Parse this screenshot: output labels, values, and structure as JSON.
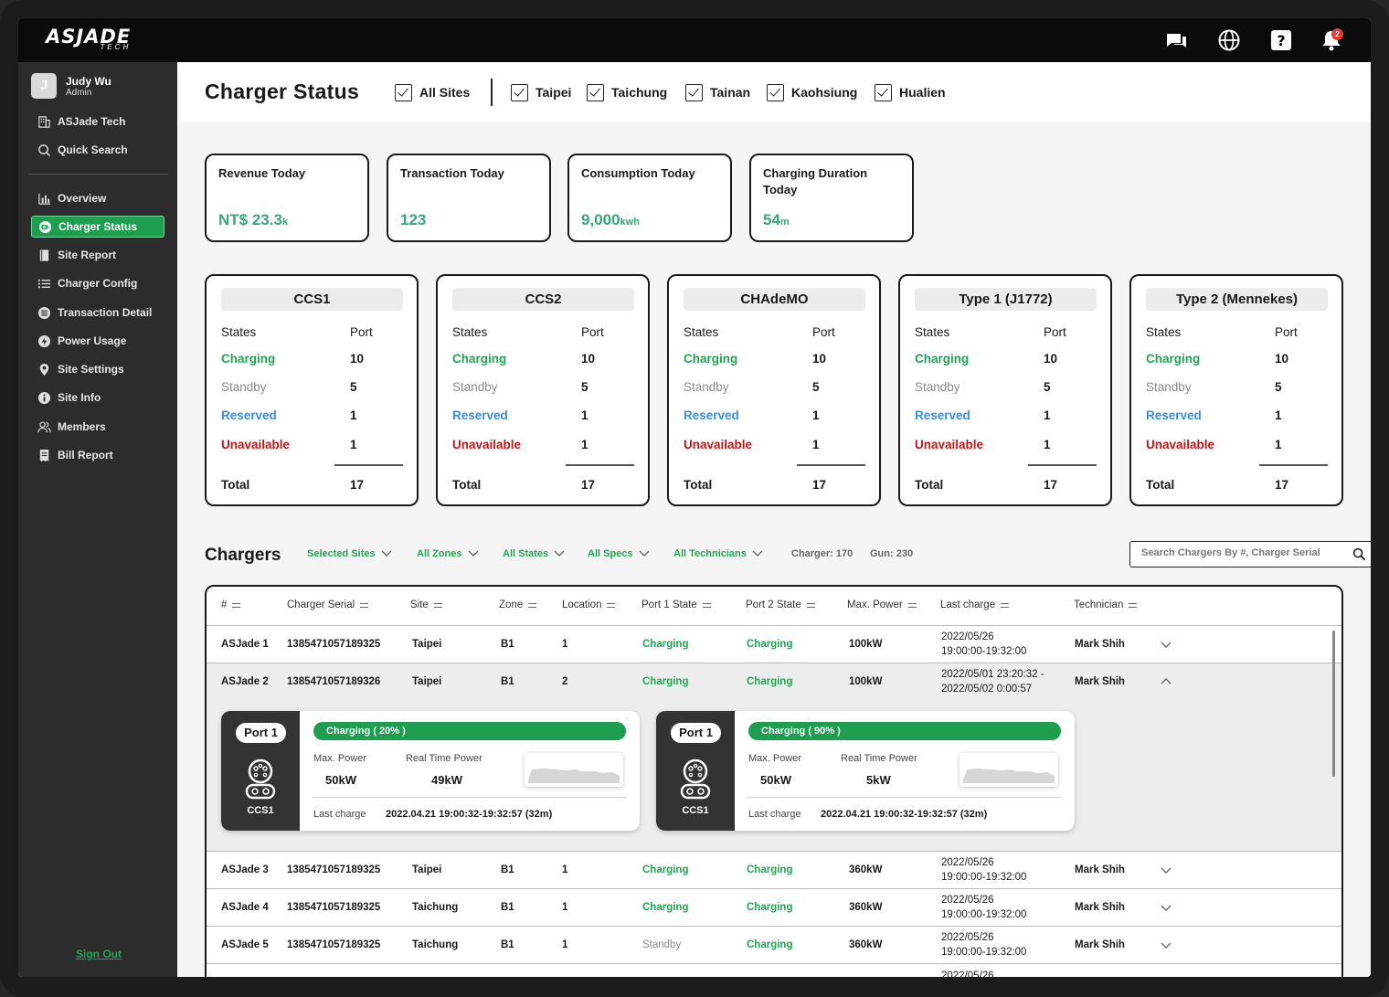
{
  "brand": {
    "logo_top": "ASJADE",
    "logo_bottom": "TECH",
    "accent": "#1e9e4f",
    "notification_count": "2"
  },
  "topbar_icons": [
    "chat-icon",
    "globe-icon",
    "help-icon",
    "bell-icon"
  ],
  "user": {
    "initial": "J",
    "name": "Judy Wu",
    "role": "Admin"
  },
  "sidebar": {
    "top_items": [
      {
        "label": "ASJade Tech",
        "icon": "building-icon"
      },
      {
        "label": "Quick Search",
        "icon": "search-icon"
      }
    ],
    "items": [
      {
        "label": "Overview",
        "icon": "bar-chart-icon"
      },
      {
        "label": "Charger Status",
        "icon": "plug-icon",
        "active": true
      },
      {
        "label": "Site Report",
        "icon": "book-icon"
      },
      {
        "label": "Charger Config",
        "icon": "list-icon"
      },
      {
        "label": "Transaction Detail",
        "icon": "menu-circle-icon"
      },
      {
        "label": "Power Usage",
        "icon": "bolt-icon"
      },
      {
        "label": "Site Settings",
        "icon": "pin-icon"
      },
      {
        "label": "Site Info",
        "icon": "info-icon"
      },
      {
        "label": "Members",
        "icon": "people-icon"
      },
      {
        "label": "Bill Report",
        "icon": "receipt-icon"
      }
    ],
    "sign_out": "Sign Out"
  },
  "header": {
    "title": "Charger Status",
    "all_sites": "All Sites",
    "sites": [
      "Taipei",
      "Taichung",
      "Tainan",
      "Kaohsiung",
      "Hualien"
    ]
  },
  "kpis": [
    {
      "title": "Revenue Today",
      "value": "NT$ 23.3",
      "unit": "k"
    },
    {
      "title": "Transaction Today",
      "value": "123",
      "unit": ""
    },
    {
      "title": "Consumption Today",
      "value": "9,000",
      "unit": "kwh"
    },
    {
      "title": "Charging Duration Today",
      "value": "54",
      "unit": "m"
    }
  ],
  "connector_headers": {
    "states": "States",
    "port": "Port",
    "total": "Total"
  },
  "connectors": [
    {
      "name": "CCS1",
      "charging": "10",
      "standby": "5",
      "reserved": "1",
      "unavailable": "1",
      "total": "17"
    },
    {
      "name": "CCS2",
      "charging": "10",
      "standby": "5",
      "reserved": "1",
      "unavailable": "1",
      "total": "17"
    },
    {
      "name": "CHAdeMO",
      "charging": "10",
      "standby": "5",
      "reserved": "1",
      "unavailable": "1",
      "total": "17"
    },
    {
      "name": "Type 1 (J1772)",
      "charging": "10",
      "standby": "5",
      "reserved": "1",
      "unavailable": "1",
      "total": "17"
    },
    {
      "name": "Type 2 (Mennekes)",
      "charging": "10",
      "standby": "5",
      "reserved": "1",
      "unavailable": "1",
      "total": "17"
    }
  ],
  "state_labels": {
    "charging": "Charging",
    "standby": "Standby",
    "reserved": "Reserved",
    "unavailable": "Unavailable"
  },
  "chargers": {
    "title": "Chargers",
    "filters": [
      "Selected Sites",
      "All Zones",
      "All States",
      "All Specs",
      "All Technicians"
    ],
    "charger_count": "Charger: 170",
    "gun_count": "Gun: 230",
    "search_placeholder": "Search Chargers By #, Charger Serial",
    "columns": [
      "#",
      "Charger Serial",
      "Site",
      "Zone",
      "Location",
      "Port 1 State",
      "Port 2 State",
      "Max. Power",
      "Last charge",
      "Technician"
    ],
    "rows": [
      {
        "id": "ASJade 1",
        "serial": "1385471057189325",
        "site": "Taipei",
        "zone": "B1",
        "location": "1",
        "port1": "Charging",
        "port2": "Charging",
        "power": "100kW",
        "last1": "2022/05/26",
        "last2": "19:00:00-19:32:00",
        "tech": "Mark Shih"
      },
      {
        "id": "ASJade 2",
        "serial": "1385471057189326",
        "site": "Taipei",
        "zone": "B1",
        "location": "2",
        "port1": "Charging",
        "port2": "Charging",
        "power": "100kW",
        "last1": "2022/05/01 23:20:32 -",
        "last2": "2022/05/02 0:00:57",
        "tech": "Mark Shih"
      },
      {
        "id": "ASJade 3",
        "serial": "1385471057189325",
        "site": "Taipei",
        "zone": "B1",
        "location": "1",
        "port1": "Charging",
        "port2": "Charging",
        "power": "360kW",
        "last1": "2022/05/26",
        "last2": "19:00:00-19:32:00",
        "tech": "Mark Shih"
      },
      {
        "id": "ASJade 4",
        "serial": "1385471057189325",
        "site": "Taichung",
        "zone": "B1",
        "location": "1",
        "port1": "Charging",
        "port2": "Charging",
        "power": "360kW",
        "last1": "2022/05/26",
        "last2": "19:00:00-19:32:00",
        "tech": "Mark Shih"
      },
      {
        "id": "ASJade 5",
        "serial": "1385471057189325",
        "site": "Taichung",
        "zone": "B1",
        "location": "1",
        "port1": "Standby",
        "port2": "Charging",
        "power": "360kW",
        "last1": "2022/05/26",
        "last2": "19:00:00-19:32:00",
        "tech": "Mark Shih"
      }
    ],
    "partial_row_date": "2022/05/26",
    "expanded_ports": [
      {
        "port": "Port 1",
        "type": "CCS1",
        "status": "Charging ( 20% )",
        "max_power_label": "Max. Power",
        "max_power": "50kW",
        "rt_label": "Real Time Power",
        "rt_power": "49kW",
        "last_label": "Last charge",
        "last": "2022.04.21 19:00:32-19:32:57 (32m)"
      },
      {
        "port": "Port 1",
        "type": "CCS1",
        "status": "Charging ( 90% )",
        "max_power_label": "Max. Power",
        "max_power": "50kW",
        "rt_label": "Real Time Power",
        "rt_power": "5kW",
        "last_label": "Last charge",
        "last": "2022.04.21 19:00:32-19:32:57 (32m)"
      }
    ]
  }
}
